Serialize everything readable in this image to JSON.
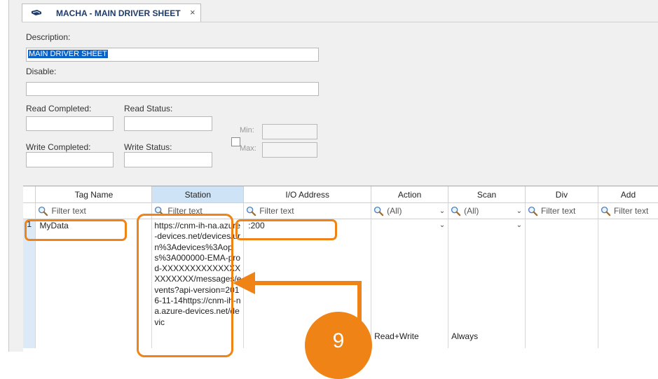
{
  "tab": {
    "title": "MACHA - MAIN DRIVER SHEET",
    "close": "×",
    "icon": "driver-icon"
  },
  "form": {
    "description_label": "Description:",
    "description_value": "MAIN DRIVER SHEET",
    "disable_label": "Disable:",
    "disable_value": "",
    "read_completed_label": "Read Completed:",
    "read_status_label": "Read Status:",
    "write_completed_label": "Write Completed:",
    "write_status_label": "Write Status:",
    "min_label": "Min:",
    "max_label": "Max:"
  },
  "grid": {
    "columns": [
      "Tag Name",
      "Station",
      "I/O Address",
      "Action",
      "Scan",
      "Div",
      "Add"
    ],
    "filter_placeholder": "Filter text",
    "filter_station": "Filter text",
    "all_option": "(All)",
    "rows": [
      {
        "num": "1",
        "tag_name": "MyData",
        "station": "https://cnm-ih-na.azure-devices.net/devices/urn%3Adevices%3Aops%3A000000-EMA-prod-XXXXXXXXXXXXXXXXXXXXX/messages/events?api-version=2016-11-14https://cnm-ih-na.azure-devices.net/devic",
        "io_address": ":200",
        "action": "Read+Write",
        "scan": "Always"
      }
    ]
  },
  "annotation": {
    "step": "9",
    "color": "#ef8316"
  }
}
